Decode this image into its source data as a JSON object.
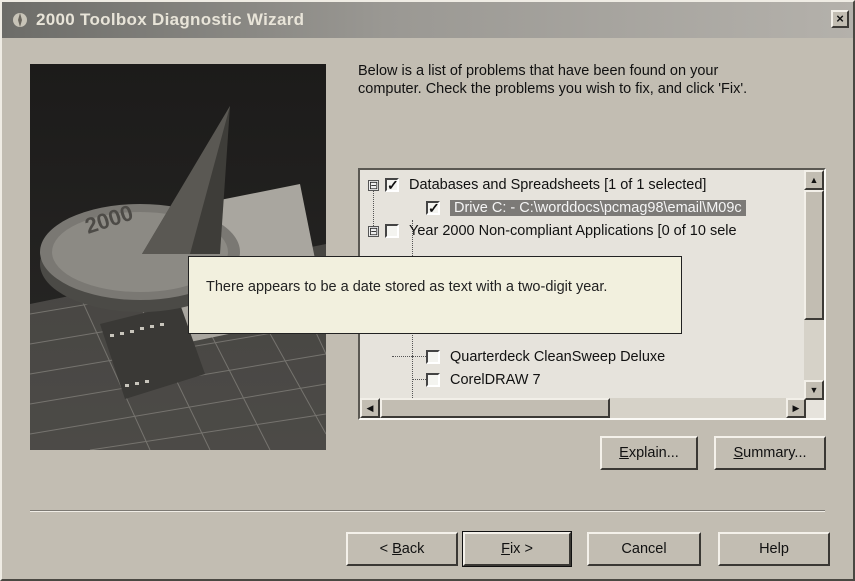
{
  "window": {
    "title": "2000 Toolbox Diagnostic Wizard",
    "close_label": "×"
  },
  "instructions": {
    "line1": "Below is a list of problems that have been found on your",
    "line2": "computer.  Check the problems you wish to fix, and click 'Fix'."
  },
  "tree": {
    "items": [
      {
        "label": "Databases and Spreadsheets  [1 of 1 selected]",
        "checked": true,
        "expander": "⊟",
        "level": 0
      },
      {
        "label": "Drive C: - C:\\worddocs\\pcmag98\\email\\M09c",
        "checked": true,
        "level": 1,
        "selected": true
      },
      {
        "label": "Year 2000 Non-compliant Applications  [0 of 10 sele",
        "checked": false,
        "expander": "⊟",
        "level": 0
      },
      {
        "label": "Quarterdeck CleanSweep Deluxe",
        "checked": false,
        "level": 1
      },
      {
        "label": "CorelDRAW 7",
        "checked": false,
        "level": 1
      }
    ]
  },
  "tooltip": {
    "text": "There appears to be a date stored as text with a two-digit year."
  },
  "buttons": {
    "explain": {
      "mnemonic": "E",
      "rest": "xplain..."
    },
    "summary": {
      "mnemonic": "S",
      "rest": "ummary..."
    },
    "back": {
      "prefix": "< ",
      "mnemonic": "B",
      "rest": "ack"
    },
    "fix": {
      "prefix": "",
      "mnemonic": "F",
      "rest": "ix >"
    },
    "cancel": "Cancel",
    "help": "Help"
  },
  "image": {
    "sundial_text": "2000"
  }
}
